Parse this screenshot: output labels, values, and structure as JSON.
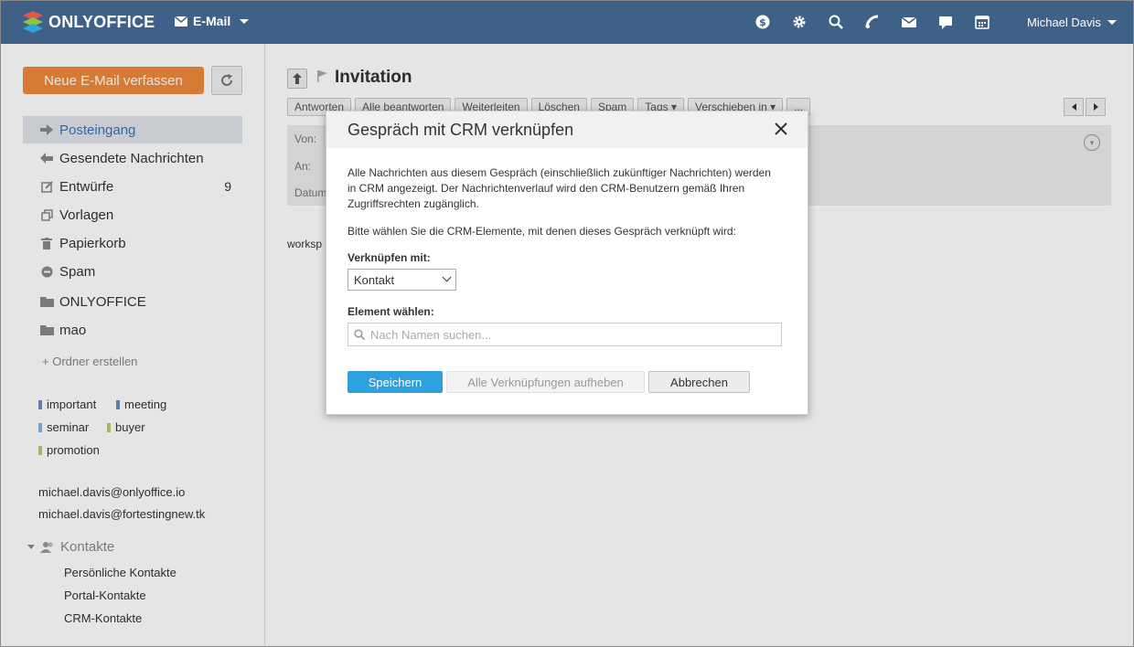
{
  "header": {
    "logo_text": "ONLYOFFICE",
    "module_label": "E-Mail",
    "user_name": "Michael Davis",
    "icons": [
      "dollar-icon",
      "gear-icon",
      "search-icon",
      "feed-icon",
      "mail-icon",
      "chat-icon",
      "calendar-icon"
    ]
  },
  "sidebar": {
    "compose_label": "Neue E-Mail verfassen",
    "folders": [
      {
        "label": "Posteingang",
        "icon": "arrow-right-icon",
        "count": ""
      },
      {
        "label": "Gesendete Nachrichten",
        "icon": "reply-icon",
        "count": ""
      },
      {
        "label": "Entwürfe",
        "icon": "edit-icon",
        "count": "9"
      },
      {
        "label": "Vorlagen",
        "icon": "copy-icon",
        "count": ""
      },
      {
        "label": "Papierkorb",
        "icon": "trash-icon",
        "count": ""
      },
      {
        "label": "Spam",
        "icon": "block-icon",
        "count": ""
      },
      {
        "label": "ONLYOFFICE",
        "icon": "folder-icon",
        "count": ""
      },
      {
        "label": "mao",
        "icon": "folder-icon",
        "count": ""
      }
    ],
    "create_folder": "+ Ordner erstellen",
    "tags": [
      {
        "label": "important",
        "color": "#6a8cc0"
      },
      {
        "label": "meeting",
        "color": "#6a8cc0"
      },
      {
        "label": "seminar",
        "color": "#7fb8d8"
      },
      {
        "label": "buyer",
        "color": "#b9c96a"
      },
      {
        "label": "promotion",
        "color": "#b9c96a"
      }
    ],
    "accounts": [
      "michael.davis@onlyoffice.io",
      "michael.davis@fortestingnew.tk"
    ],
    "contacts": {
      "title": "Kontakte",
      "items": [
        "Persönliche Kontakte",
        "Portal-Kontakte",
        "CRM-Kontakte"
      ]
    }
  },
  "message": {
    "subject": "Invitation",
    "toolbar": [
      "Antworten",
      "Alle beantworten",
      "Weiterleiten",
      "Löschen",
      "Spam",
      "Tags ▾",
      "Verschieben in ▾",
      "..."
    ],
    "labels": {
      "from": "Von:",
      "to": "An:",
      "date": "Datum"
    },
    "body_snippet": "worksp"
  },
  "dialog": {
    "title": "Gespräch mit CRM verknüpfen",
    "description": "Alle Nachrichten aus diesem Gespräch (einschließlich zukünftiger Nachrichten) werden in CRM angezeigt. Der Nachrichtenverlauf wird den CRM-Benutzern gemäß Ihren Zugriffsrechten zugänglich.",
    "pick_text": "Bitte wählen Sie die CRM-Elemente, mit denen dieses Gespräch verknüpft wird:",
    "link_with_label": "Verknüpfen mit:",
    "link_with_value": "Kontakt",
    "element_label": "Element wählen:",
    "search_placeholder": "Nach Namen suchen...",
    "save_label": "Speichern",
    "unlink_label": "Alle Verknüpfungen aufheben",
    "cancel_label": "Abbrechen"
  }
}
